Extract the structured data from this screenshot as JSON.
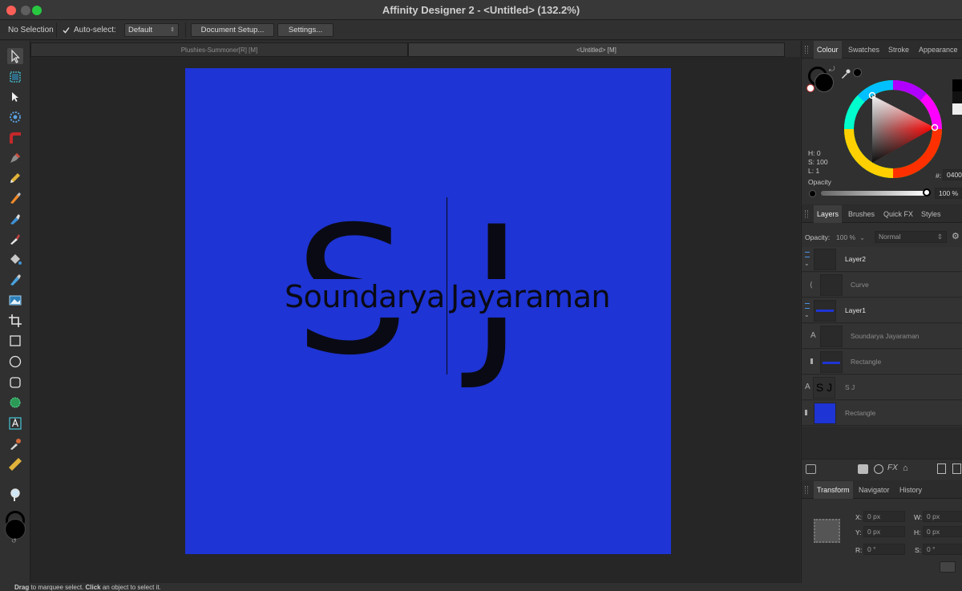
{
  "window": {
    "title": "Affinity Designer 2 - <Untitled> (132.2%)"
  },
  "context_toolbar": {
    "selection": "No Selection",
    "auto_select_label": "Auto-select:",
    "auto_select_value": "Default",
    "document_setup": "Document Setup...",
    "settings": "Settings..."
  },
  "tabs": [
    {
      "label": "Plushies-Summoner[R] [M]"
    },
    {
      "label": "<Untitled> [M]"
    }
  ],
  "artwork": {
    "monogram_left": "S",
    "monogram_right": "J",
    "name_left": "Soundarya",
    "name_right": "Jayaraman",
    "background_color": "#1e34d4",
    "ink_color": "#0a0a14"
  },
  "colour_panel": {
    "tabs": [
      "Colour",
      "Swatches",
      "Stroke",
      "Appearance"
    ],
    "h": "H: 0",
    "s": "S: 100",
    "l": "L: 1",
    "hex_label": "#:",
    "hex_value": "0400",
    "opacity_label": "Opacity",
    "opacity_value": "100 %"
  },
  "layers_panel": {
    "tabs": [
      "Layers",
      "Brushes",
      "Quick FX",
      "Styles"
    ],
    "opacity_label": "Opacity:",
    "opacity_value": "100 %",
    "blend_mode": "Normal",
    "layers": [
      {
        "name": "Layer2"
      },
      {
        "name": "Curve"
      },
      {
        "name": "Layer1"
      },
      {
        "name": "Soundarya Jayaraman"
      },
      {
        "name": "Rectangle"
      },
      {
        "name": "S J"
      },
      {
        "name": "Rectangle"
      }
    ]
  },
  "transform_panel": {
    "tabs": [
      "Transform",
      "Navigator",
      "History"
    ],
    "x_label": "X:",
    "x_value": "0 px",
    "y_label": "Y:",
    "y_value": "0 px",
    "w_label": "W:",
    "w_value": "0 px",
    "h_label": "H:",
    "h_value": "0 px",
    "r_label": "R:",
    "r_value": "0 °",
    "s_label": "S:",
    "s_value": "0 °"
  },
  "status": {
    "drag": "Drag",
    "drag_text": " to marquee select. ",
    "click": "Click",
    "click_text": " an object to select it."
  }
}
